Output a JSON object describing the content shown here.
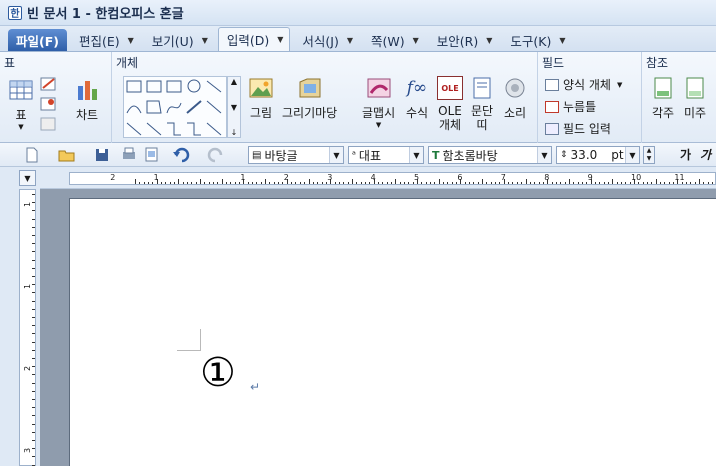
{
  "window": {
    "app_icon": "한",
    "title": "빈 문서 1 - 한컴오피스 혼글"
  },
  "tabs": [
    {
      "label": "파일(F)",
      "dropdown": false
    },
    {
      "label": "편집(E)",
      "dropdown": true
    },
    {
      "label": "보기(U)",
      "dropdown": true
    },
    {
      "label": "입력(D)",
      "dropdown": true
    },
    {
      "label": "서식(J)",
      "dropdown": true
    },
    {
      "label": "쪽(W)",
      "dropdown": true
    },
    {
      "label": "보안(R)",
      "dropdown": true
    },
    {
      "label": "도구(K)",
      "dropdown": true
    }
  ],
  "dropdown_glyph": "▼",
  "ribbon": {
    "groups": {
      "table": "표",
      "object": "개체",
      "field": "필드",
      "reference": "참조"
    },
    "buttons": {
      "table": "표",
      "chart": "차트",
      "picture": "그림",
      "drawing_wizard": "그리기마당",
      "glyph_art": "글맵시",
      "formula": "수식",
      "ole": "OLE 개체",
      "ole_icon_text": "OLE",
      "column": "문단 띠",
      "sound": "소리",
      "footnote": "각주",
      "endnote": "미주",
      "formula_icon_text": "f∞"
    },
    "field_items": [
      {
        "label": "양식 개체"
      },
      {
        "label": "누름틀"
      },
      {
        "label": "필드 입력"
      }
    ]
  },
  "toolbar": {
    "style_combo": "바탕글",
    "lang_combo": "대표",
    "font_combo": "함초롬바탕",
    "size_value": "33.0",
    "size_unit": "pt",
    "bold_label": "가",
    "italic_label": "가"
  },
  "ruler": {
    "top_numbers": [
      "2",
      "1",
      "1",
      "2",
      "3",
      "4",
      "5",
      "6",
      "7",
      "8",
      "9",
      "10",
      "11"
    ],
    "left_numbers": [
      "1",
      "1",
      "2",
      "3"
    ]
  },
  "document": {
    "text": "①",
    "paragraph_mark": "↵"
  },
  "colors": {
    "accent": "#2f5fa8",
    "ribbon_bg": "#e8f0f9",
    "workspace": "#8f9cad"
  }
}
